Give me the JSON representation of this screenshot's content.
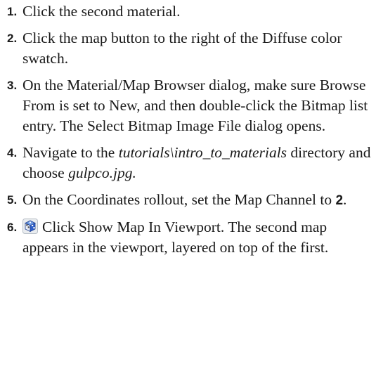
{
  "steps": [
    {
      "number": "1.",
      "text": "Click the second material."
    },
    {
      "number": "2.",
      "text": "Click the map button to the right of the Diffuse color swatch."
    },
    {
      "number": "3.",
      "text": "On the Material/Map Browser dialog, make sure Browse From is set to New, and then double-click the Bitmap list entry. The Select Bitmap Image File dialog opens."
    },
    {
      "number": "4.",
      "text_before": "Navigate to the ",
      "path": "tutorials\\intro_to_materials",
      "text_mid": " directory and choose ",
      "file": "gulpco.jpg."
    },
    {
      "number": "5.",
      "text_before": "On the Coordinates rollout, set the Map Channel to ",
      "value": "2",
      "text_after": "."
    },
    {
      "number": "6.",
      "icon": "show-map-in-viewport-icon",
      "text": "Click Show Map In Viewport. The second map appears in the viewport, layered on top of the first."
    }
  ]
}
